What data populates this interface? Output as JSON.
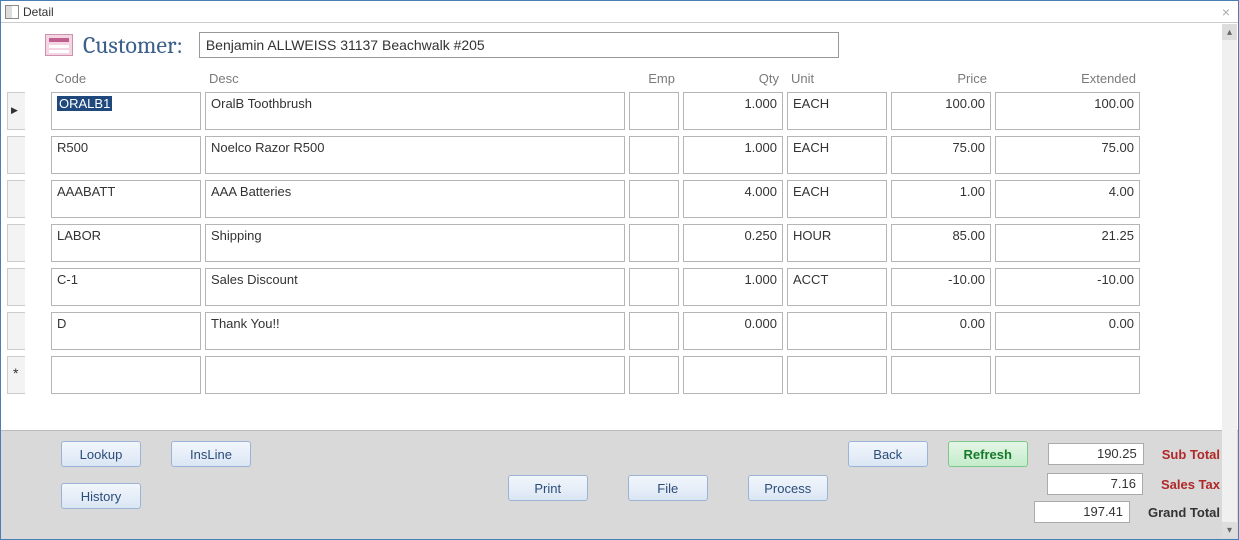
{
  "window": {
    "title": "Detail"
  },
  "header": {
    "customer_label": "Customer:",
    "customer_value": "Benjamin ALLWEISS 31137 Beachwalk #205"
  },
  "columns": {
    "code": "Code",
    "desc": "Desc",
    "emp": "Emp",
    "qty": "Qty",
    "unit": "Unit",
    "price": "Price",
    "extended": "Extended"
  },
  "rows": [
    {
      "code": "ORALB1",
      "desc": "OralB Toothbrush",
      "emp": "",
      "qty": "1.000",
      "unit": "EACH",
      "price": "100.00",
      "extended": "100.00",
      "selected": true
    },
    {
      "code": "R500",
      "desc": "Noelco Razor R500",
      "emp": "",
      "qty": "1.000",
      "unit": "EACH",
      "price": "75.00",
      "extended": "75.00"
    },
    {
      "code": "AAABATT",
      "desc": "AAA Batteries",
      "emp": "",
      "qty": "4.000",
      "unit": "EACH",
      "price": "1.00",
      "extended": "4.00"
    },
    {
      "code": "LABOR",
      "desc": "Shipping",
      "emp": "",
      "qty": "0.250",
      "unit": "HOUR",
      "price": "85.00",
      "extended": "21.25"
    },
    {
      "code": "C-1",
      "desc": "Sales Discount",
      "emp": "",
      "qty": "1.000",
      "unit": "ACCT",
      "price": "-10.00",
      "extended": "-10.00"
    },
    {
      "code": "D",
      "desc": "Thank You!!",
      "emp": "",
      "qty": "0.000",
      "unit": "",
      "price": "0.00",
      "extended": "0.00"
    },
    {
      "code": "",
      "desc": "",
      "emp": "",
      "qty": "",
      "unit": "",
      "price": "",
      "extended": "",
      "new": true
    }
  ],
  "buttons": {
    "lookup": "Lookup",
    "insline": "InsLine",
    "history": "History",
    "print": "Print",
    "file": "File",
    "process": "Process",
    "back": "Back",
    "refresh": "Refresh"
  },
  "totals": {
    "subtotal_label": "Sub Total",
    "subtotal": "190.25",
    "salestax_label": "Sales Tax",
    "salestax": "7.16",
    "grandtotal_label": "Grand Total",
    "grandtotal": "197.41"
  }
}
